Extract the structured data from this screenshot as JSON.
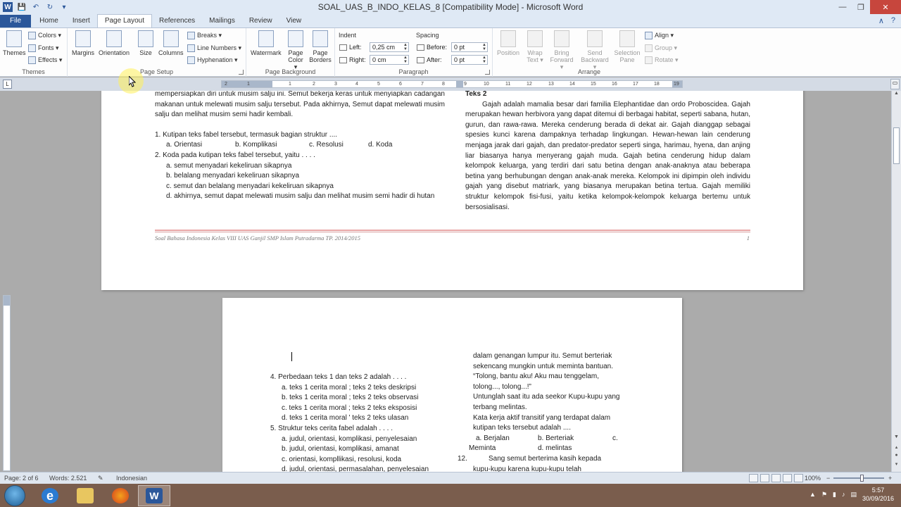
{
  "window": {
    "title": "SOAL_UAS_B_INDO_KELAS_8 [Compatibility Mode] - Microsoft Word",
    "minimize": "—",
    "restore": "❐",
    "close": "✕"
  },
  "qat": {
    "app_icon": "W",
    "save": "💾",
    "undo": "↶",
    "redo": "↻",
    "customize": "▾"
  },
  "tabs": [
    "File",
    "Home",
    "Insert",
    "Page Layout",
    "References",
    "Mailings",
    "Review",
    "View"
  ],
  "tab_icons": {
    "minimize_ribbon": "∧",
    "help": "?"
  },
  "ribbon": {
    "themes": {
      "themes": "Themes",
      "colors": "Colors ▾",
      "fonts": "Fonts ▾",
      "effects": "Effects ▾",
      "label": "Themes"
    },
    "page_setup": {
      "margins": "Margins",
      "orientation": "Orientation",
      "size": "Size",
      "columns": "Columns",
      "breaks": "Breaks ▾",
      "line_numbers": "Line Numbers ▾",
      "hyphenation": "Hyphenation ▾",
      "label": "Page Setup"
    },
    "page_background": {
      "watermark": "Watermark",
      "page_color": "Page Color ▾",
      "page_borders": "Page Borders",
      "label": "Page Background"
    },
    "paragraph": {
      "indent_header": "Indent",
      "spacing_header": "Spacing",
      "left_label": "Left:",
      "left_value": "0,25 cm",
      "right_label": "Right:",
      "right_value": "0 cm",
      "before_label": "Before:",
      "before_value": "0 pt",
      "after_label": "After:",
      "after_value": "0 pt",
      "label": "Paragraph"
    },
    "arrange": {
      "position": "Position",
      "wrap_text": "Wrap Text ▾",
      "bring_forward": "Bring Forward ▾",
      "send_backward": "Send Backward ▾",
      "selection_pane": "Selection Pane",
      "align": "Align ▾",
      "group": "Group ▾",
      "rotate": "Rotate ▾",
      "label": "Arrange"
    }
  },
  "ruler": {
    "ticks": [
      "2",
      "1",
      "1",
      "2",
      "3",
      "4",
      "5",
      "6",
      "7",
      "8",
      "9",
      "10",
      "11",
      "12",
      "13",
      "14",
      "15",
      "16",
      "17",
      "18",
      "19"
    ],
    "tab_selector": "L"
  },
  "page1": {
    "col1_intro": "mempersiapkan diri untuk musim salju ini. Semut bekerja keras untuk menyiapkan cadangan makanan untuk melewati musim salju tersebut. Pada akhirnya, Semut dapat melewati musim salju dan melihat musim semi hadir kembali.",
    "q1": "1.  Kutipan teks fabel tersebut, termasuk bagian struktur ....",
    "q1_opts": [
      "a.  Orientasi",
      "b.  Komplikasi",
      "c.  Resolusi",
      "d.  Koda"
    ],
    "q2": "2.  Koda pada kutipan teks fabel tersebut, yaitu . . . .",
    "q2_a": "a.  semut menyadari kekeliruan sikapnya",
    "q2_b": "b.  belalang menyadari kekeliruan sikapnya",
    "q2_c": "c.  semut dan belalang menyadari kekeliruan sikapnya",
    "q2_d": "d.  akhirnya, semut dapat melewati musim salju dan melihat musim semi hadir di hutan",
    "col2_title": "Teks 2",
    "col2_body": "Gajah adalah mamalia besar dari familia Elephantidae dan ordo Proboscidea. Gajah merupakan hewan herbivora yang dapat ditemui di berbagai habitat, seperti sabana, hutan, gurun, dan rawa-rawa. Mereka cenderung berada di dekat air. Gajah dianggap sebagai spesies kunci karena dampaknya terhadap lingkungan. Hewan-hewan lain cenderung menjaga jarak dari gajah, dan predator-predator seperti singa, harimau, hyena, dan anjing liar biasanya hanya menyerang gajah muda. Gajah betina cenderung hidup dalam kelompok keluarga, yang terdiri dari satu betina dengan anak-anaknya atau beberapa betina yang berhubungan dengan anak-anak mereka. Kelompok ini dipimpin oleh individu gajah yang disebut matriark, yang biasanya merupakan betina tertua. Gajah memiliki struktur kelompok fisi-fusi, yaitu ketika kelompok-kelompok keluarga bertemu untuk bersosialisasi.",
    "footer": "Soal Bahasa Indonesia Kelas VIII UAS Ganjil SMP Islam Putradarma TP. 2014/2015",
    "page_number": "1"
  },
  "page2": {
    "q4": "4.  Perbedaan teks 1 dan teks 2 adalah . . . .",
    "q4_opts": [
      "a. teks 1 cerita moral ; teks 2 teks deskripsi",
      "b. teks 1 cerita moral ; teks 2 teks observasi",
      "c. teks 1 cerita moral ; teks 2 teks eksposisi",
      "d. teks 1 cerita moral ' teks 2 teks ulasan"
    ],
    "q5": "5.  Struktur teks cerita fabel adalah . . . .",
    "q5_opts": [
      "a. judul, orientasi, komplikasi, penyelesaian",
      "b. judul, orientasi, komplikasi, amanat",
      "c. orientasi, kompllikasi, resolusi, koda",
      "d. judul, orientasi, permasalahan, penyelesaian"
    ],
    "col2_l1": "dalam genangan lumpur itu. Semut berteriak",
    "col2_l2": "sekencang mungkin untuk meminta bantuan.",
    "col2_l3": "“Tolong,   bantu   aku!   Aku   mau   tenggelam,",
    "col2_l4": "tolong..., tolong...!”",
    "col2_l5": "Untunglah saat itu ada seekor Kupu-kupu yang",
    "col2_l6": "terbang melintas.",
    "col2_l7": "Kata kerja aktif transitif yang terdapat dalam",
    "col2_l8": "kutipan teks tersebut adalah ....",
    "col2_opt_a": "a.  Berjalan",
    "col2_opt_b": "b.  Berteriak",
    "col2_opt_c": "c.",
    "col2_opt_c2": "Meminta",
    "col2_opt_d": "d.  melintas",
    "q12_num": "12.",
    "q12_text": "Sang    semut    berterima    kasih    kepada",
    "q12_next": "kupu-kupu     karena     kupu-kupu     telah"
  },
  "status": {
    "page": "Page: 2 of 6",
    "words": "Words: 2.521",
    "language": "Indonesian",
    "zoom": "100%",
    "zoom_minus": "−",
    "zoom_plus": "+"
  },
  "taskbar": {
    "time": "5:57",
    "date": "30/09/2016",
    "word_icon": "W",
    "ie_icon": "e"
  },
  "colors": {
    "accent": "#2b579a",
    "close": "#c7463d",
    "taskbar": "#7a5d4d"
  }
}
